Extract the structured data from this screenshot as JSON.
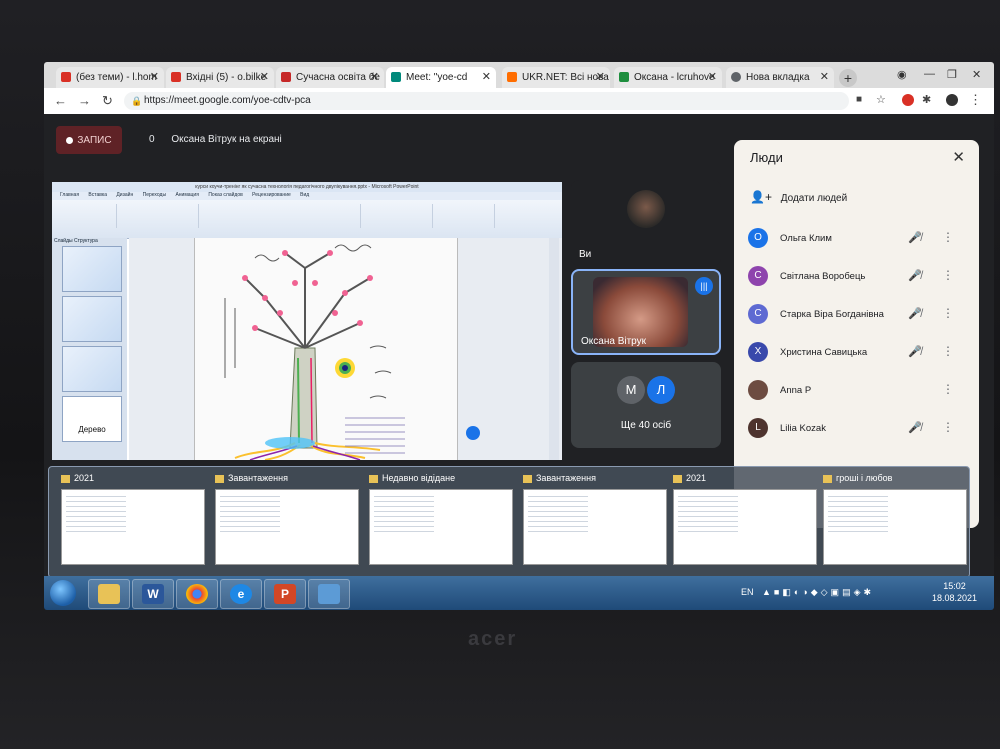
{
  "browser": {
    "tabs": [
      {
        "label": "(без теми) - l.hom",
        "color": "#d93025"
      },
      {
        "label": "Вхідні (5) - o.bilke",
        "color": "#d93025"
      },
      {
        "label": "Сучасна освіта бе",
        "color": "#c62828"
      },
      {
        "label": "Meet: \"yoe-cd",
        "color": "#00897b"
      },
      {
        "label": "UKR.NET: Всі нова",
        "color": "#ff6d00"
      },
      {
        "label": "Оксана - lcruhove",
        "color": "#1e8e3e"
      },
      {
        "label": "Нова вкладка",
        "color": "#5f6368"
      }
    ],
    "url": "https://meet.google.com/yoe-cdtv-pca"
  },
  "meet": {
    "record_label": "ЗАПИС",
    "count": "0",
    "presenting_text": "Оксана Вітрук на екрані",
    "self_label": "Ви",
    "speaker_label": "Оксана Вітрук",
    "more_avatars": [
      {
        "letter": "М",
        "color": "#5f6368"
      },
      {
        "letter": "Л",
        "color": "#1a73e8"
      }
    ],
    "more_label": "Ще 40 осіб"
  },
  "presentation": {
    "window_title": "курси коучи-тренінг як сучасна технологія педагогічного двулікування.pptx - Microsoft PowerPoint",
    "ribbon_tabs": [
      "Главная",
      "Вставка",
      "Дизайн",
      "Переходы",
      "Анимация",
      "Показ слайдов",
      "Рецензирование",
      "Вид"
    ],
    "panel_tabs": "Слайды  Структура",
    "thumb_label": "Дерево"
  },
  "people_panel": {
    "title": "Люди",
    "add_label": "Додати людей",
    "people": [
      {
        "initial": "О",
        "name": "Ольга Клим",
        "color": "#1a73e8"
      },
      {
        "initial": "С",
        "name": "Світлана Воробець",
        "color": "#8e44ad"
      },
      {
        "initial": "С",
        "name": "Старка Віра Богданівна",
        "color": "#5e6ad2"
      },
      {
        "initial": "Х",
        "name": "Христина Савицька",
        "color": "#3949ab"
      },
      {
        "initial": "",
        "name": "Anna P",
        "color": "#6d4c41"
      },
      {
        "initial": "L",
        "name": "Lilia Kozak",
        "color": "#4e342e"
      }
    ]
  },
  "taskbar_previews": [
    {
      "title": "2021"
    },
    {
      "title": "Завантаження"
    },
    {
      "title": "Недавно відідане"
    },
    {
      "title": "Завантаження"
    },
    {
      "title": "2021"
    },
    {
      "title": "гроші і любов"
    }
  ],
  "taskbar": {
    "language": "EN",
    "time": "15:02",
    "date": "18.08.2021"
  },
  "laptop_brand": "acer"
}
